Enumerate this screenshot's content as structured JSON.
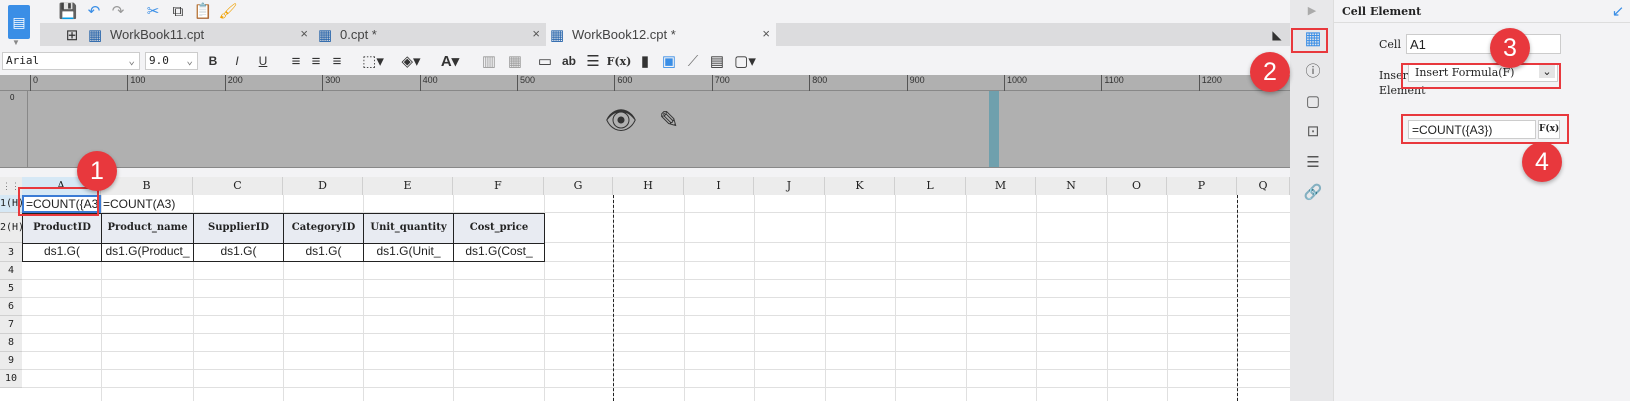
{
  "tabs": [
    {
      "label": "WorkBook11.cpt"
    },
    {
      "label": "0.cpt *"
    },
    {
      "label": "WorkBook12.cpt *"
    }
  ],
  "toolbar": {
    "font": "Arial",
    "size": "9.0",
    "bold": "B",
    "italic": "I",
    "underline": "U",
    "ab": "ab",
    "fx": "F(x)"
  },
  "ruler": [
    "0",
    "100",
    "200",
    "300",
    "400",
    "500",
    "600",
    "700",
    "800",
    "900",
    "1000",
    "1100",
    "1200"
  ],
  "columns": [
    "A",
    "B",
    "C",
    "D",
    "E",
    "F",
    "G",
    "H",
    "I",
    "J",
    "K",
    "L",
    "M",
    "N",
    "O",
    "P",
    "Q"
  ],
  "rows": [
    "1(H)",
    "2(H)",
    "3",
    "4",
    "5",
    "6",
    "7",
    "8",
    "9",
    "10"
  ],
  "cells": {
    "a1": "=COUNT({A3}",
    "b1": "=COUNT(A3)",
    "headers": [
      "ProductID",
      "Product_name",
      "SupplierID",
      "CategoryID",
      "Unit_quantity",
      "Cost_price"
    ],
    "row3": [
      "ds1.G(",
      "ds1.G(Product_",
      "ds1.G(",
      "ds1.G(",
      "ds1.G(Unit_",
      "ds1.G(Cost_"
    ]
  },
  "panel": {
    "title": "Cell Element",
    "cell_label": "Cell",
    "cell_value": "A1",
    "insert_label": "Insert Cell Element",
    "insert_value": "Insert Formula(F)",
    "formula_value": "=COUNT({A3})",
    "fx": "F(x)"
  },
  "badges": [
    "1",
    "2",
    "3",
    "4"
  ]
}
